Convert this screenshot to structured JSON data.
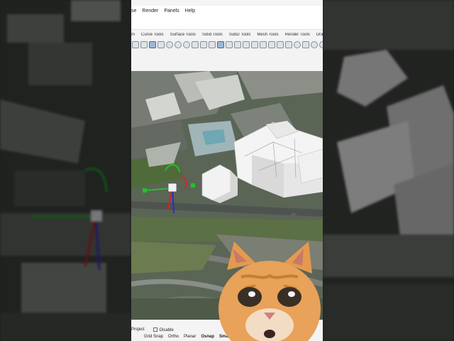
{
  "menu": {
    "items": [
      "se",
      "Render",
      "Panels",
      "Help"
    ]
  },
  "tabs": [
    "m",
    "Curve Tools",
    "Surface Tools",
    "Solid Tools",
    "SubD Tools",
    "Mesh Tools",
    "Render Tools",
    "Drafting"
  ],
  "toolbar": {
    "icons": [
      "select-icon",
      "open-icon",
      "save-icon",
      "print-icon",
      "settings-icon",
      "zoom-icon",
      "snap-icon",
      "gumball-icon",
      "pan-icon",
      "rotate-icon",
      "layer-icon",
      "properties-icon",
      "mesh-icon",
      "light-icon",
      "render-icon",
      "dim-icon",
      "curve-icon",
      "loft-icon",
      "twist-icon",
      "ring-icon",
      "person-icon",
      "sun-icon",
      "target-icon"
    ]
  },
  "status": {
    "project_label": "Project",
    "disable_label": "Disable",
    "toggles": [
      "Grid Snap",
      "Ortho",
      "Planar",
      "Osnap",
      "SmartTr"
    ]
  },
  "colors": {
    "accent": "#3a6db5",
    "gumball_x": "#e0202a",
    "gumball_y": "#22c02a",
    "gumball_z": "#2020d0"
  }
}
